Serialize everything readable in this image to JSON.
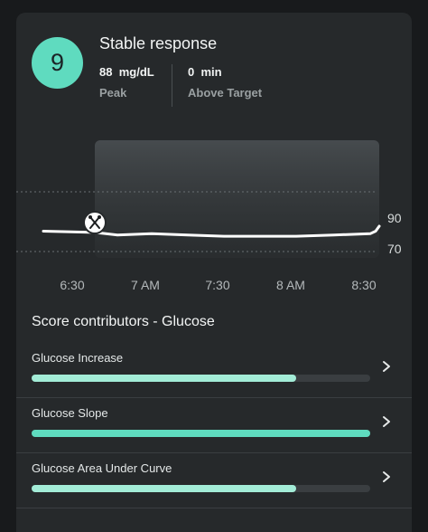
{
  "score": {
    "value": "9",
    "title": "Stable response",
    "peak_value": "88",
    "peak_unit": "mg/dL",
    "peak_label": "Peak",
    "above_value": "0",
    "above_unit": "min",
    "above_label": "Above Target",
    "accent_color": "#5fdbbf"
  },
  "chart_data": {
    "type": "line",
    "x": [
      "6:15",
      "6:30",
      "6:40",
      "6:50",
      "7:00",
      "7:15",
      "7:30",
      "7:45",
      "8:00",
      "8:15",
      "8:30",
      "8:35"
    ],
    "values": [
      79,
      78,
      76,
      77,
      76,
      75,
      75,
      75,
      76,
      77,
      79,
      83
    ],
    "x_ticks": [
      "6:30",
      "7 AM",
      "7:30",
      "8 AM",
      "8:30"
    ],
    "y_ticks": [
      "90",
      "70"
    ],
    "ylim": [
      60,
      110
    ],
    "grid_lines": [
      90,
      70
    ],
    "meal_marker_icon": "fork-knife-icon",
    "highlight_region": "post-meal window"
  },
  "contributors": {
    "title": "Score contributors - Glucose",
    "items": [
      {
        "label": "Glucose Increase",
        "level": 0.78,
        "color": "#a3ecd7"
      },
      {
        "label": "Glucose Slope",
        "level": 1.0,
        "color": "#5fdbbf"
      },
      {
        "label": "Glucose Area Under Curve",
        "level": 0.78,
        "color": "#a3ecd7"
      }
    ]
  }
}
